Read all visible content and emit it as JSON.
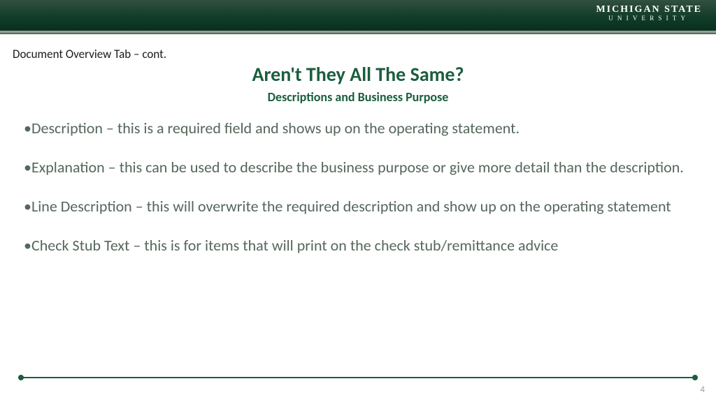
{
  "logo": {
    "line1": "MICHIGAN STATE",
    "line2": "UNIVERSITY"
  },
  "breadcrumb": "Document Overview Tab – cont.",
  "title": "Aren't They All The Same?",
  "subtitle": "Descriptions and Business Purpose",
  "bullets": [
    "Description – this is a required field and shows up on the operating statement.",
    "Explanation – this can be used to describe the business purpose or give more detail than the description.",
    "Line Description – this will overwrite the required description and show up on the operating statement",
    "Check Stub Text – this is for items that will print on the check stub/remittance advice"
  ],
  "page_number": "4"
}
